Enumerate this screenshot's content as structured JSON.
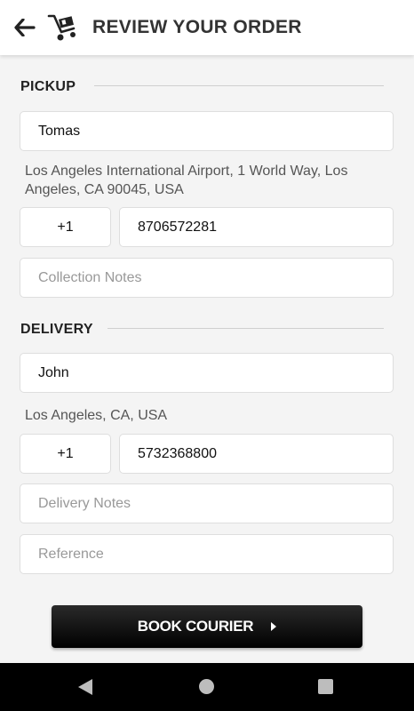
{
  "header": {
    "title": "REVIEW YOUR ORDER",
    "back_icon": "back-arrow-icon",
    "logo_icon": "courier-cart-logo"
  },
  "pickup": {
    "section_title": "PICKUP",
    "name": "Tomas",
    "address": "Los Angeles International Airport, 1 World Way, Los Angeles, CA 90045, USA",
    "country_code": "+1",
    "phone": "8706572281",
    "notes_placeholder": "Collection Notes"
  },
  "delivery": {
    "section_title": "DELIVERY",
    "name": "John",
    "address": "Los Angeles, CA, USA",
    "country_code": "+1",
    "phone": "5732368800",
    "notes_placeholder": "Delivery Notes",
    "reference_placeholder": "Reference"
  },
  "actions": {
    "book_label": "BOOK COURIER"
  },
  "navbar": {
    "back_icon": "nav-back-icon",
    "home_icon": "nav-home-icon",
    "recent_icon": "nav-recent-apps-icon"
  }
}
